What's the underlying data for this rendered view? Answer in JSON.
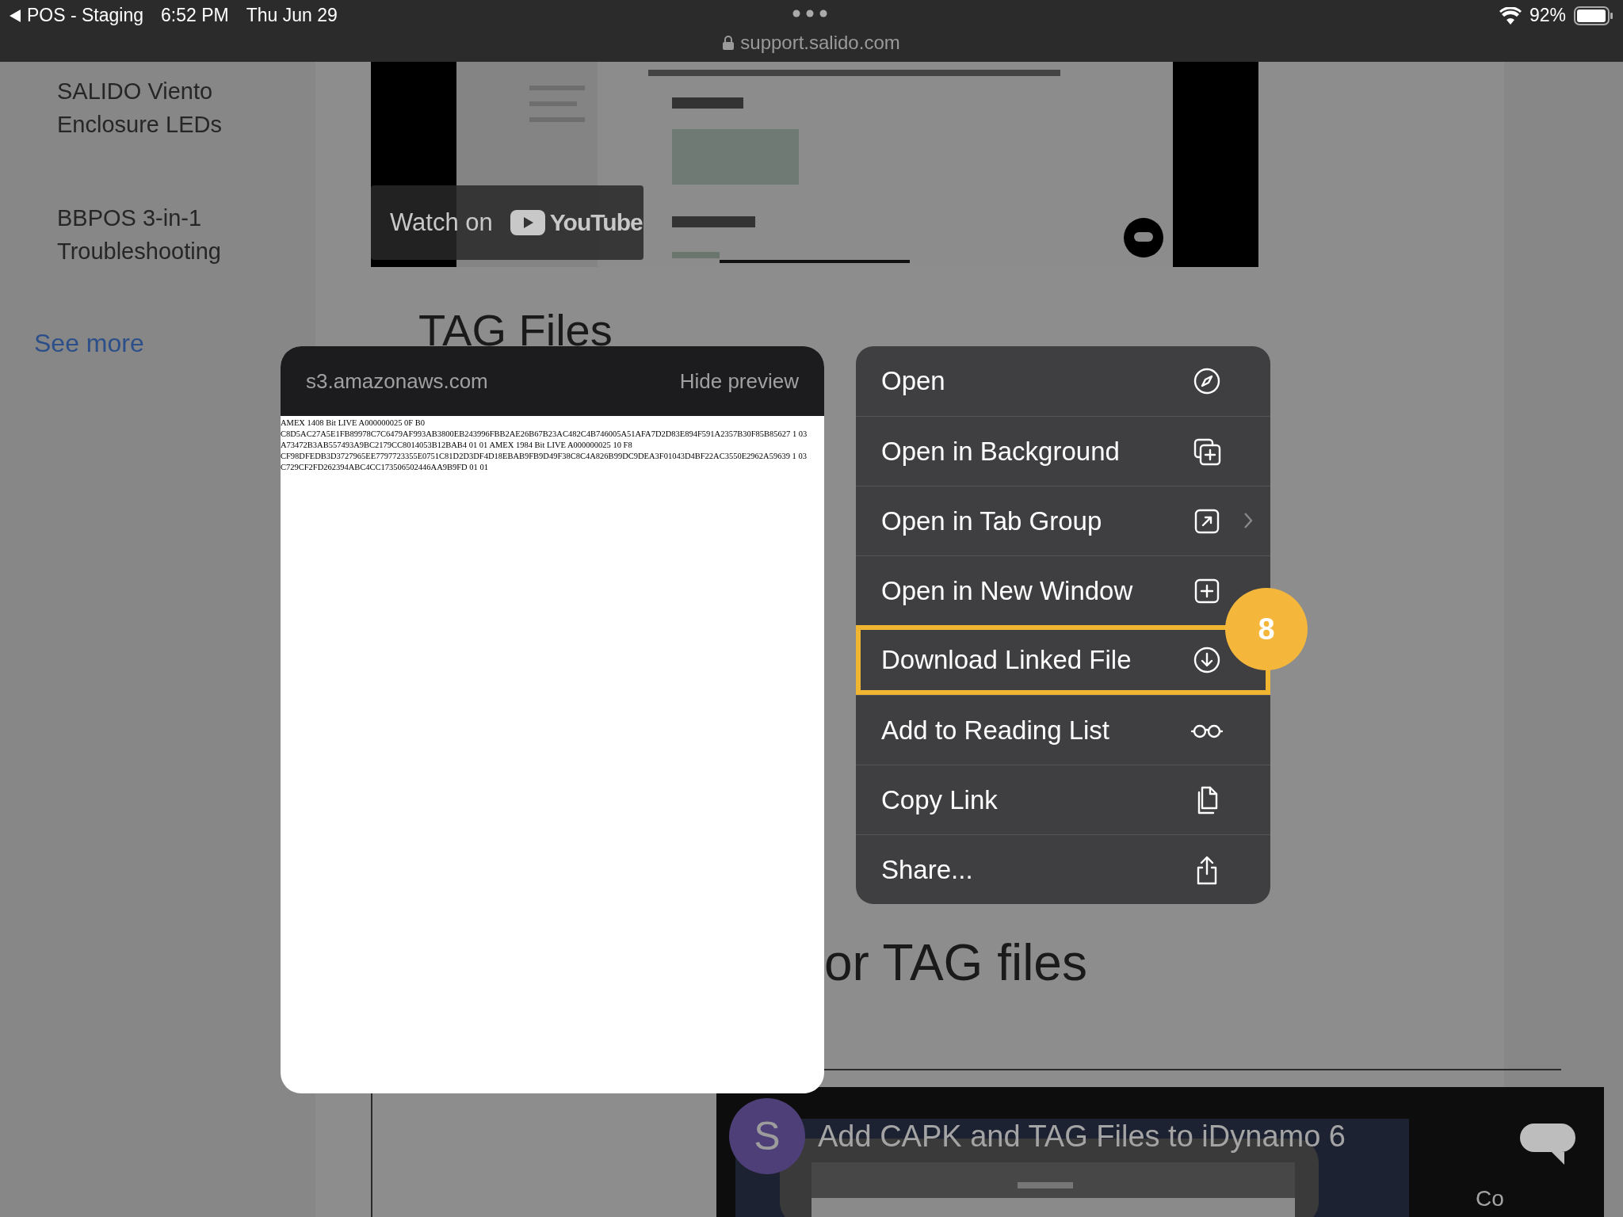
{
  "status_bar": {
    "back_label": "POS - Staging",
    "time": "6:52 PM",
    "date": "Thu Jun 29",
    "battery": "92%"
  },
  "address_bar": {
    "domain": "support.salido.com"
  },
  "sidebar": {
    "links": [
      "SALIDO Viento Enclosure LEDs",
      "BBPOS 3-in-1 Troubleshooting"
    ],
    "see_more": "See more"
  },
  "video_top": {
    "kind": "picture",
    "watch_on": "Watch on",
    "platform": "YouTube"
  },
  "heading": "TAG Files",
  "heading_2": "or TAG files",
  "preview": {
    "domain": "s3.amazonaws.com",
    "hide_button": "Hide preview",
    "text": "AMEX 1408 Bit LIVE A000000025 0F B0 C8D5AC27A5E1FB89978C7C6479AF993AB3800EB243996FBB2AE26B67B23AC482C4B746005A51AFA7D2D83E894F591A2357B30F85B85627 1 03 A73472B3AB557493A9BC2179CC8014053B12BAB4 01 01 AMEX 1984 Bit LIVE A000000025 10 F8 CF98DFEDB3D3727965EE7797723355E0751C81D2D3DF4D18EBAB9FB9D49F38C8C4A826B99DC9DEA3F01043D4BF22AC3550E2962A59639 1 03 C729CF2FD262394ABC4CC173506502446AA9B9FD 01 01"
  },
  "menu": {
    "items": [
      {
        "label": "Open",
        "highlighted": false,
        "submenu": false
      },
      {
        "label": "Open in Background",
        "highlighted": false,
        "submenu": false
      },
      {
        "label": "Open in Tab Group",
        "highlighted": false,
        "submenu": true
      },
      {
        "label": "Open in New Window",
        "highlighted": false,
        "submenu": false
      },
      {
        "label": "Download Linked File",
        "highlighted": true,
        "submenu": false
      },
      {
        "label": "Add to Reading List",
        "highlighted": false,
        "submenu": false
      },
      {
        "label": "Copy Link",
        "highlighted": false,
        "submenu": false
      },
      {
        "label": "Share...",
        "highlighted": false,
        "submenu": false
      }
    ],
    "badge": "8"
  },
  "video_bottom": {
    "kind": "picture",
    "channel_initial": "S",
    "title": "Add CAPK and TAG Files to iDynamo 6",
    "side_text": "Co"
  }
}
